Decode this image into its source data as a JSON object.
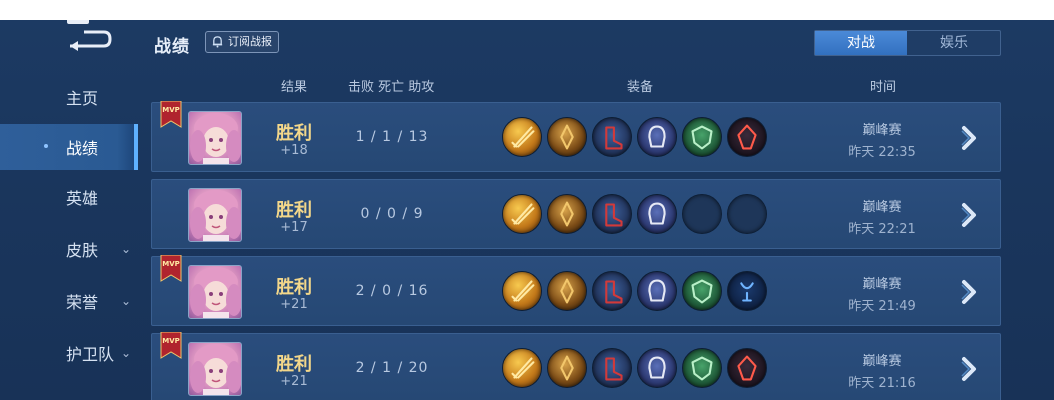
{
  "sidebar": {
    "items": [
      {
        "label": "主页",
        "chevron": false
      },
      {
        "label": "战绩",
        "chevron": false,
        "active": true
      },
      {
        "label": "英雄",
        "chevron": false
      },
      {
        "label": "皮肤",
        "chevron": true
      },
      {
        "label": "荣誉",
        "chevron": true
      },
      {
        "label": "护卫队",
        "chevron": true
      }
    ],
    "chevron_glyph": "⌄"
  },
  "header": {
    "title": "战绩",
    "subscribe_label": "订阅战报",
    "tabs": [
      {
        "label": "对战",
        "active": true
      },
      {
        "label": "娱乐",
        "active": false
      }
    ]
  },
  "columns": {
    "result": "结果",
    "kda": "击败 死亡 助攻",
    "equipment": "装备",
    "time": "时间"
  },
  "colors": {
    "accent": "#3f80d0",
    "result_win": "#f3d78a",
    "mvp_red": "#b0242e"
  },
  "matches": [
    {
      "mvp": true,
      "badge_text": "MVP",
      "result": "胜利",
      "score": "+18",
      "kda": "1 / 1 / 13",
      "items": [
        "gold-blade",
        "bronze-sword",
        "crimson-boots",
        "skull-helm",
        "jade-shield",
        "red-crystal"
      ],
      "mode": "巅峰赛",
      "time": "昨天 22:35"
    },
    {
      "mvp": false,
      "badge_text": "",
      "result": "胜利",
      "score": "+17",
      "kda": "0 / 0 / 9",
      "items": [
        "gold-blade",
        "bronze-sword",
        "crimson-boots",
        "skull-helm",
        "empty",
        "empty"
      ],
      "mode": "巅峰赛",
      "time": "昨天 22:21"
    },
    {
      "mvp": true,
      "badge_text": "MVP",
      "result": "胜利",
      "score": "+21",
      "kda": "2 / 0 / 16",
      "items": [
        "gold-blade",
        "bronze-sword",
        "crimson-boots",
        "skull-helm",
        "jade-shield",
        "blue-amulet"
      ],
      "mode": "巅峰赛",
      "time": "昨天 21:49"
    },
    {
      "mvp": true,
      "badge_text": "MVP",
      "result": "胜利",
      "score": "+21",
      "kda": "2 / 1 / 20",
      "items": [
        "gold-blade",
        "bronze-sword",
        "crimson-boots",
        "skull-helm",
        "jade-shield",
        "red-crystal"
      ],
      "mode": "巅峰赛",
      "time": "昨天 21:16"
    }
  ]
}
